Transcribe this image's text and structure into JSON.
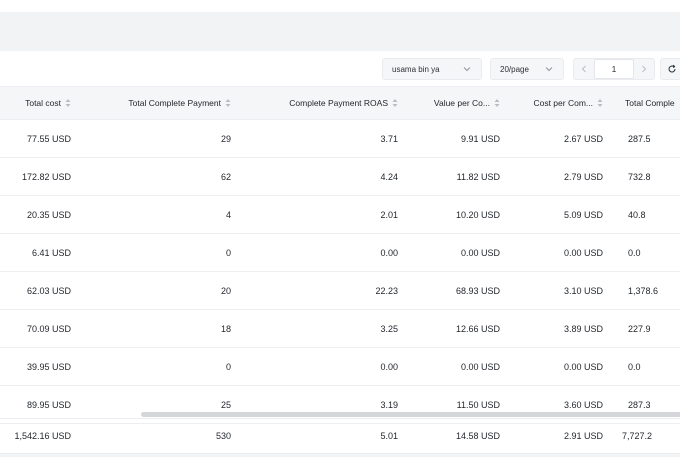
{
  "toolbar": {
    "account_select": "usama bin ya",
    "page_size_select": "20/page",
    "current_page": "1"
  },
  "columns": [
    "Total cost",
    "Total Complete Payment",
    "Complete Payment ROAS",
    "Value per Co...",
    "Cost per Com...",
    "Total Comple"
  ],
  "rows": [
    [
      "77.55 USD",
      "29",
      "3.71",
      "9.91 USD",
      "2.67 USD",
      "287.5"
    ],
    [
      "172.82 USD",
      "62",
      "4.24",
      "11.82 USD",
      "2.79 USD",
      "732.8"
    ],
    [
      "20.35 USD",
      "4",
      "2.01",
      "10.20 USD",
      "5.09 USD",
      "40.8"
    ],
    [
      "6.41 USD",
      "0",
      "0.00",
      "0.00 USD",
      "0.00 USD",
      "0.0"
    ],
    [
      "62.03 USD",
      "20",
      "22.23",
      "68.93 USD",
      "3.10 USD",
      "1,378.6"
    ],
    [
      "70.09 USD",
      "18",
      "3.25",
      "12.66 USD",
      "3.89 USD",
      "227.9"
    ],
    [
      "39.95 USD",
      "0",
      "0.00",
      "0.00 USD",
      "0.00 USD",
      "0.0"
    ],
    [
      "89.95 USD",
      "25",
      "3.19",
      "11.50 USD",
      "3.60 USD",
      "287.3"
    ]
  ],
  "totals": [
    "1,542.16 USD",
    "530",
    "5.01",
    "14.58 USD",
    "2.91 USD",
    "7,727.2"
  ],
  "icons": {
    "dropdown": "chevron-down-icon",
    "prev": "chevron-left-icon",
    "next": "chevron-right-icon",
    "refresh": "refresh-icon",
    "sort": "sort-icon"
  }
}
